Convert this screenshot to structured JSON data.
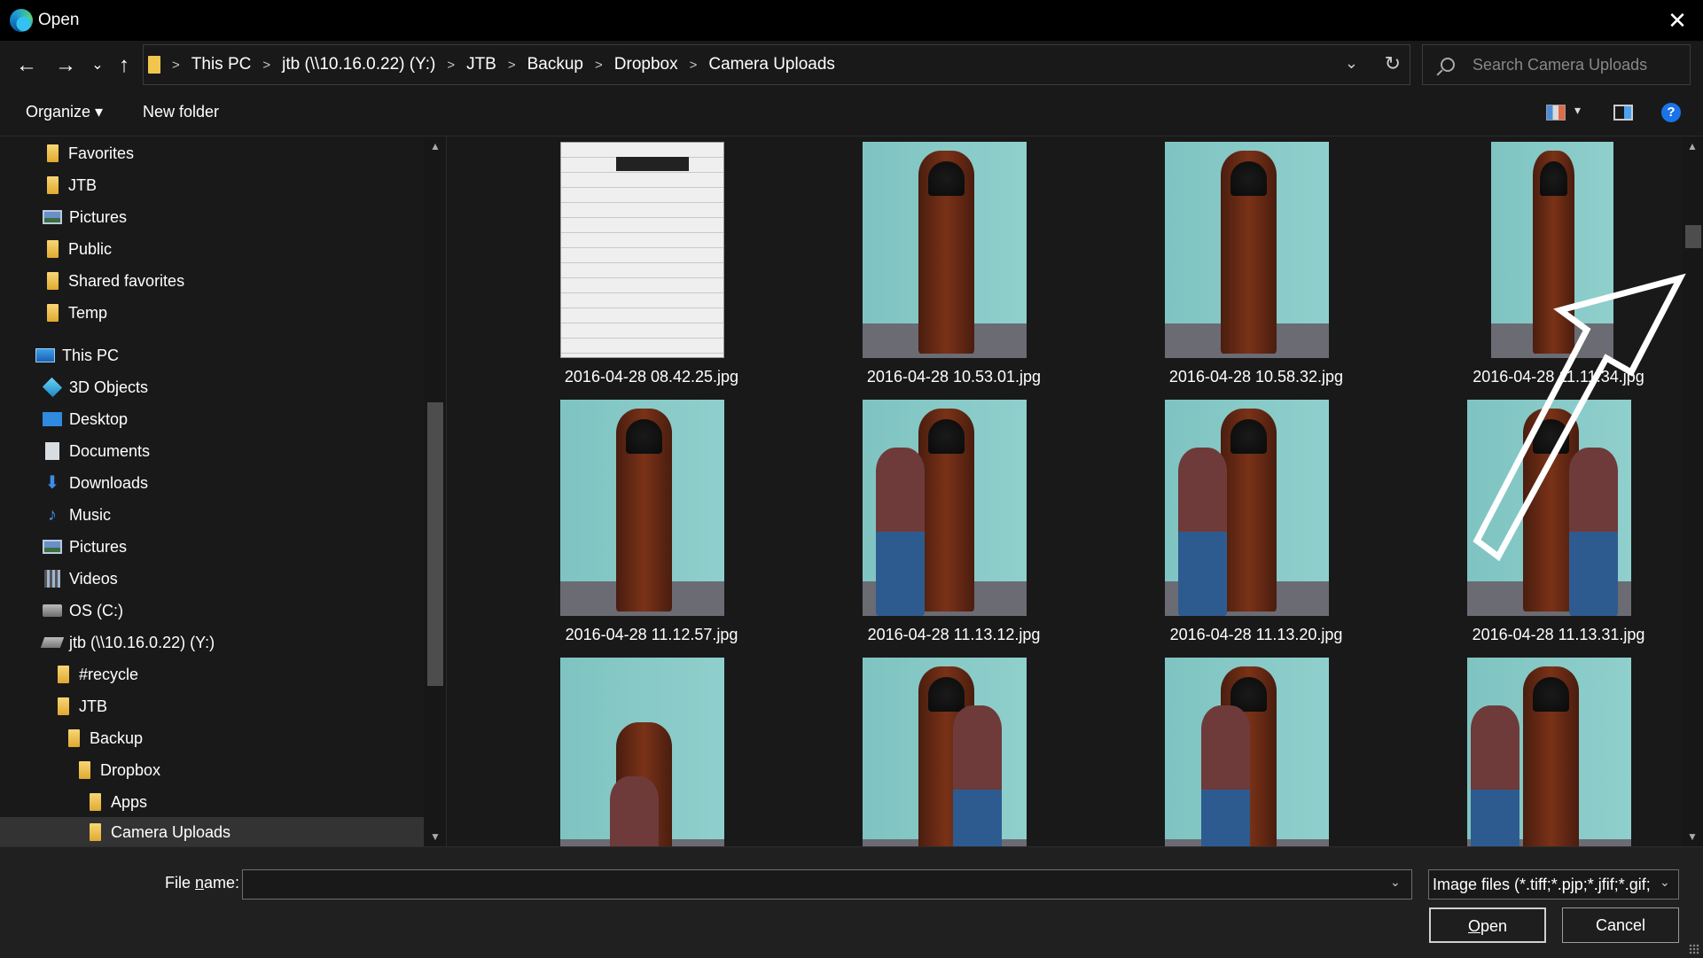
{
  "window": {
    "title": "Open",
    "close_glyph": "✕"
  },
  "nav": {
    "back_glyph": "←",
    "forward_glyph": "→",
    "recent_glyph": "⌄",
    "up_glyph": "↑"
  },
  "address": {
    "crumbs": [
      "This PC",
      "jtb (\\\\10.16.0.22) (Y:)",
      "JTB",
      "Backup",
      "Dropbox",
      "Camera Uploads"
    ],
    "separator": ">",
    "dropdown_glyph": "⌄",
    "refresh_glyph": "↻"
  },
  "search": {
    "placeholder": "Search Camera Uploads"
  },
  "toolbar": {
    "organize_label": "Organize ▾",
    "new_folder_label": "New folder",
    "view_dropdown_glyph": "▾",
    "help_glyph": "?"
  },
  "sidebar": {
    "items": [
      {
        "label": "Favorites",
        "icon": "folder-icon"
      },
      {
        "label": "JTB",
        "icon": "folder-icon"
      },
      {
        "label": "Pictures",
        "icon": "pictures-icon"
      },
      {
        "label": "Public",
        "icon": "folder-icon"
      },
      {
        "label": "Shared favorites",
        "icon": "folder-icon"
      },
      {
        "label": "Temp",
        "icon": "folder-icon"
      },
      {
        "label": "This PC",
        "icon": "computer-icon"
      },
      {
        "label": "3D Objects",
        "icon": "3d-objects-icon"
      },
      {
        "label": "Desktop",
        "icon": "desktop-icon"
      },
      {
        "label": "Documents",
        "icon": "documents-icon"
      },
      {
        "label": "Downloads",
        "icon": "downloads-icon"
      },
      {
        "label": "Music",
        "icon": "music-icon"
      },
      {
        "label": "Pictures",
        "icon": "pictures-icon"
      },
      {
        "label": "Videos",
        "icon": "videos-icon"
      },
      {
        "label": "OS (C:)",
        "icon": "drive-icon"
      },
      {
        "label": "jtb (\\\\10.16.0.22) (Y:)",
        "icon": "network-drive-icon"
      },
      {
        "label": "#recycle",
        "icon": "folder-icon"
      },
      {
        "label": "JTB",
        "icon": "folder-icon"
      },
      {
        "label": "Backup",
        "icon": "folder-icon"
      },
      {
        "label": "Dropbox",
        "icon": "folder-icon"
      },
      {
        "label": "Apps",
        "icon": "folder-icon"
      },
      {
        "label": "Camera Uploads",
        "icon": "folder-icon",
        "selected": true
      }
    ],
    "music_glyph": "♪",
    "downloads_glyph": "⬇"
  },
  "files": [
    {
      "name": "2016-04-28 08.42.25.jpg",
      "kind": "document-photo"
    },
    {
      "name": "2016-04-28 10.53.01.jpg",
      "kind": "clock-photo"
    },
    {
      "name": "2016-04-28 10.58.32.jpg",
      "kind": "clock-photo"
    },
    {
      "name": "2016-04-28 11.11.34.jpg",
      "kind": "clock-photo"
    },
    {
      "name": "2016-04-28 11.12.57.jpg",
      "kind": "clock-photo"
    },
    {
      "name": "2016-04-28 11.13.12.jpg",
      "kind": "clock-person-photo"
    },
    {
      "name": "2016-04-28 11.13.20.jpg",
      "kind": "clock-person-photo"
    },
    {
      "name": "2016-04-28 11.13.31.jpg",
      "kind": "clock-person-photo"
    },
    {
      "name": "",
      "kind": "clock-person-photo"
    },
    {
      "name": "",
      "kind": "clock-person-photo"
    },
    {
      "name": "",
      "kind": "clock-person-photo"
    },
    {
      "name": "",
      "kind": "clock-person-photo"
    }
  ],
  "bottom": {
    "file_name_label_pre": "File ",
    "file_name_label_u": "n",
    "file_name_label_post": "ame:",
    "file_name_value": "",
    "file_type": "Image files (*.tiff;*.pjp;*.jfif;*.gif;",
    "dropdown_glyph": "⌄",
    "open_label_u": "O",
    "open_label_rest": "pen",
    "cancel_label": "Cancel"
  },
  "colors": {
    "window_bg": "#191919",
    "titlebar_bg": "#000000",
    "folder": "#f2c54f",
    "accent": "#1a73e8",
    "overlay_arrow": "#ffffff"
  }
}
